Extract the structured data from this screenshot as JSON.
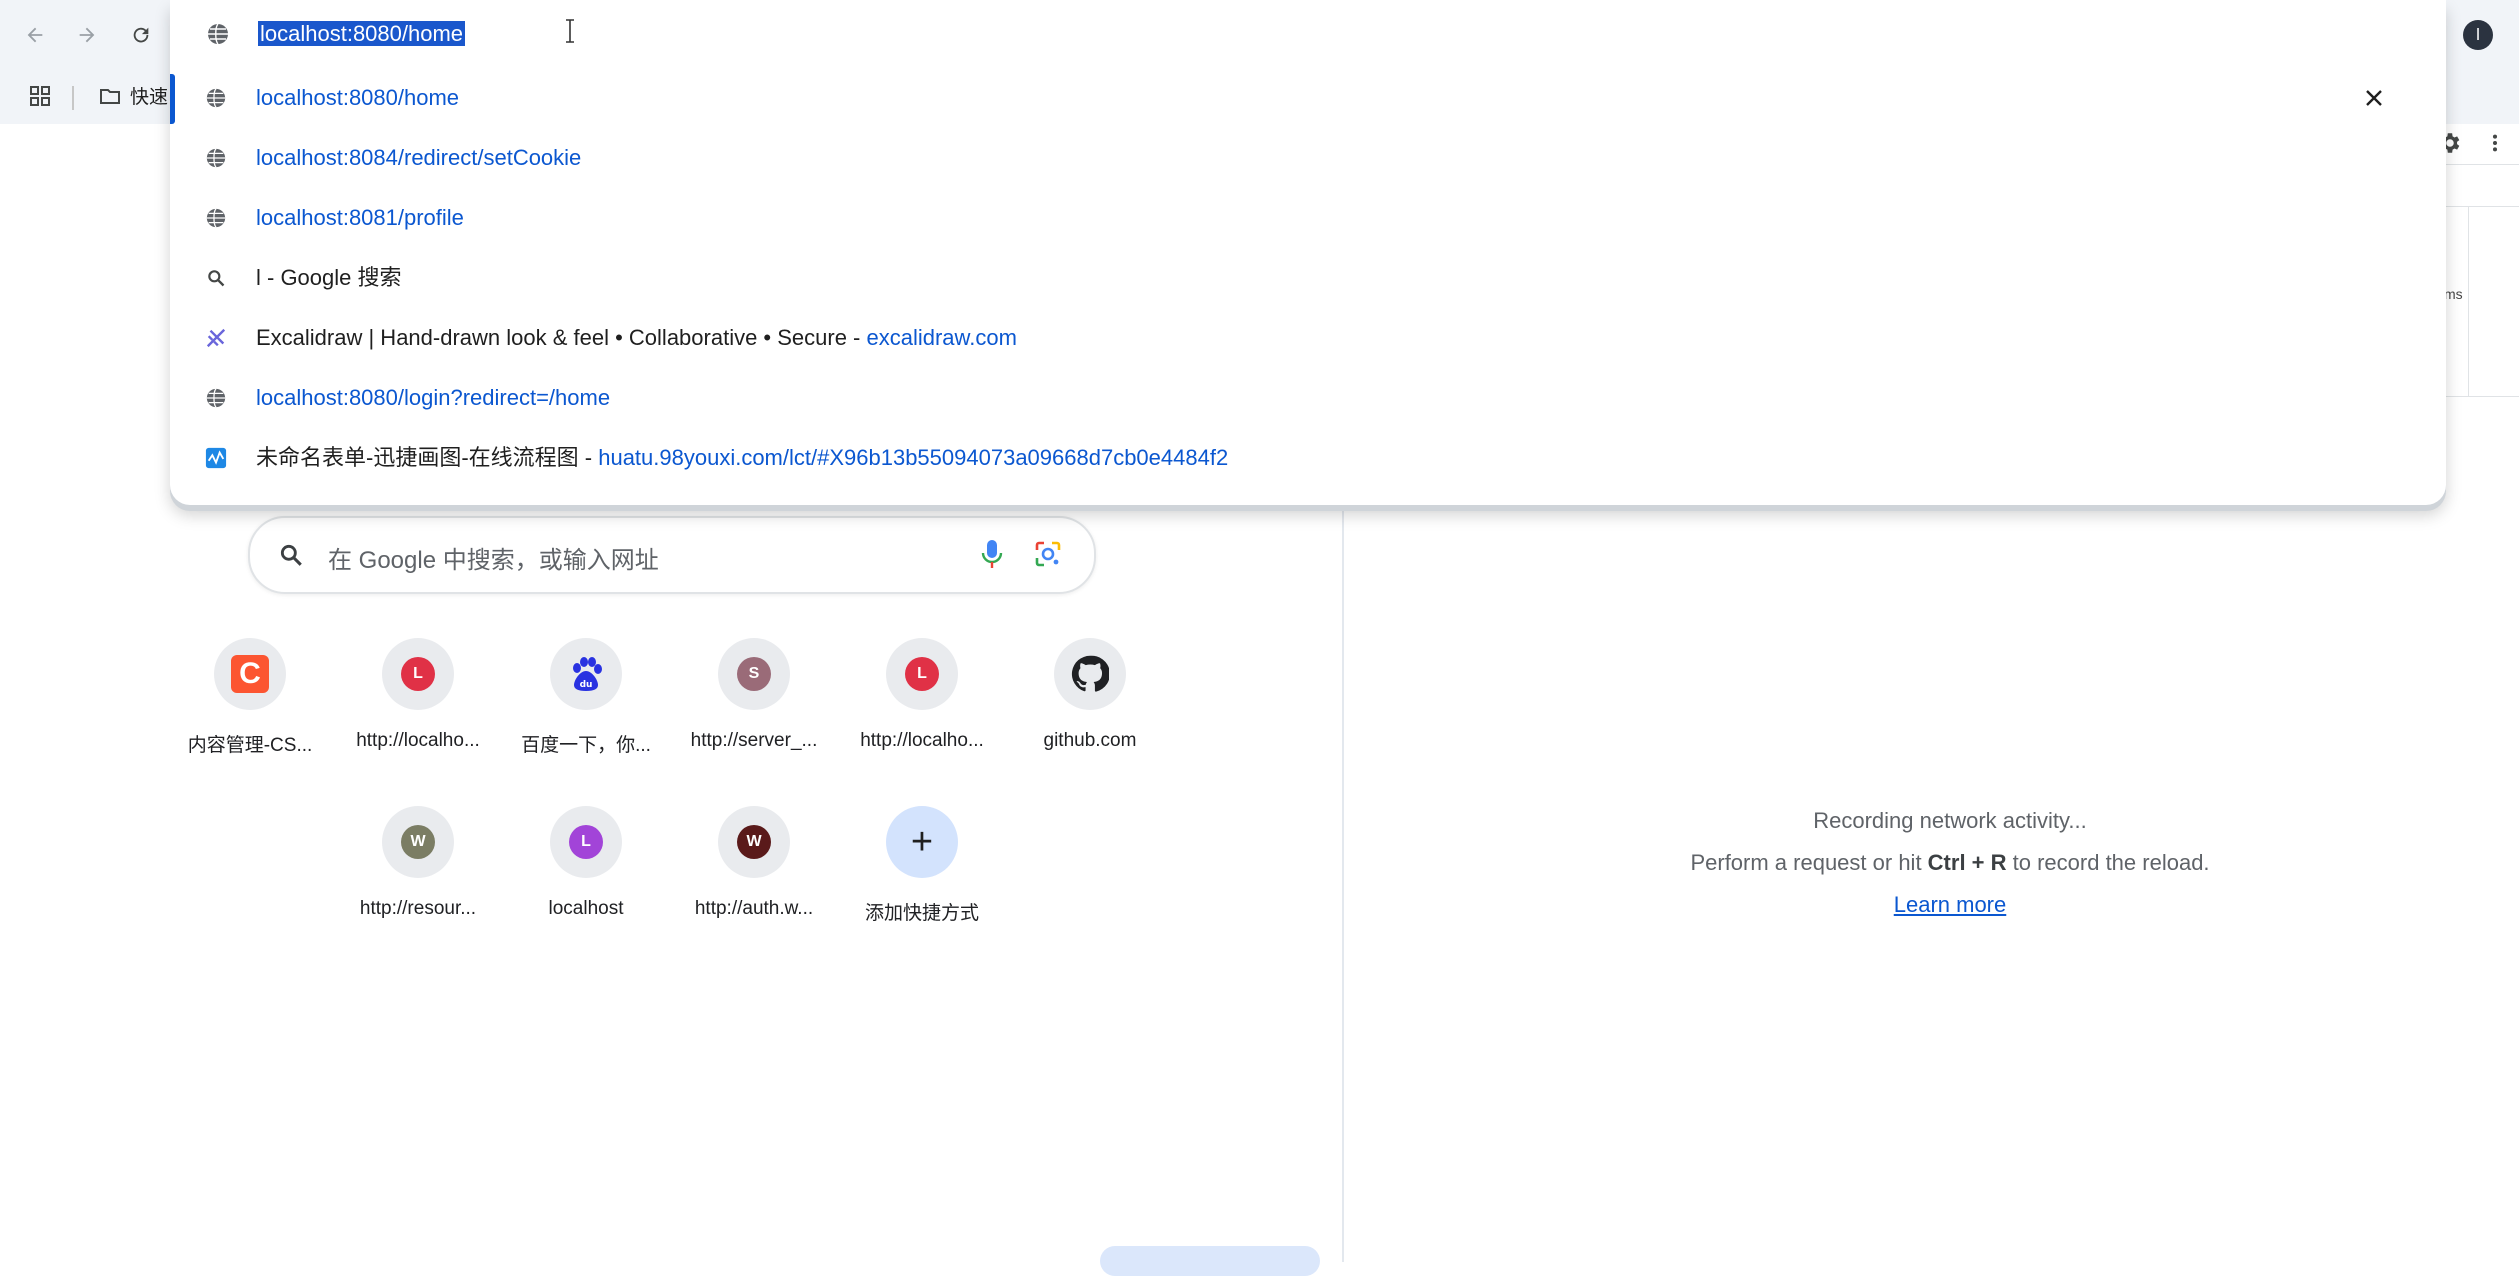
{
  "omnibox": {
    "text": "localhost:8080/home",
    "suggestions": [
      {
        "text": "localhost:8080/home",
        "icon": "globe-icon"
      },
      {
        "text": "localhost:8084/redirect/setCookie",
        "icon": "globe-icon"
      },
      {
        "text": "localhost:8081/profile",
        "icon": "globe-icon"
      },
      {
        "text": "l - Google 搜索",
        "icon": "search-icon"
      },
      {
        "text": "Excalidraw | Hand-drawn look & feel • Collaborative • Secure - ",
        "url": "excalidraw.com",
        "icon": "excalidraw-icon"
      },
      {
        "text": "localhost:8080/login?redirect=/home",
        "icon": "globe-icon"
      },
      {
        "text": "未命名表单-迅捷画图-在线流程图 - ",
        "url": "huatu.98youxi.com/lct/#X96b13b55094073a09668d7cb0e4484f2",
        "icon": "huatu-icon"
      }
    ]
  },
  "bookmarks": {
    "folder_label": "快速"
  },
  "profile": {
    "initial": "l"
  },
  "ntp": {
    "search_placeholder": "在 Google 中搜索，或输入网址",
    "shortcuts": [
      {
        "label": "内容管理-CS...",
        "icon": "csdn-icon",
        "letter": "C",
        "color": "#fc5531"
      },
      {
        "label": "http://localho...",
        "icon": "letter-icon",
        "letter": "L",
        "color": "#e03146"
      },
      {
        "label": "百度一下，你...",
        "icon": "baidu-icon",
        "letter": "du",
        "color": "#2932e1"
      },
      {
        "label": "http://server_...",
        "icon": "letter-icon",
        "letter": "S",
        "color": "#9a6b78"
      },
      {
        "label": "http://localho...",
        "icon": "letter-icon",
        "letter": "L",
        "color": "#e03146"
      },
      {
        "label": "github.com",
        "icon": "github-icon",
        "letter": "",
        "color": "#202124"
      },
      {
        "label": "http://resour...",
        "icon": "letter-icon",
        "letter": "W",
        "color": "#7b7d64"
      },
      {
        "label": "localhost",
        "icon": "letter-icon",
        "letter": "L",
        "color": "#a244d8"
      },
      {
        "label": "http://auth.w...",
        "icon": "letter-icon",
        "letter": "W",
        "color": "#5a1a1a"
      },
      {
        "label": "添加快捷方式",
        "icon": "plus-icon",
        "letter": "+",
        "color": "#1f1f1f"
      }
    ]
  },
  "devtools": {
    "timeline_unit": "ms",
    "recording": "Recording network activity...",
    "hint_prefix": "Perform a request or hit ",
    "hint_keys": "Ctrl + R",
    "hint_suffix": " to record the reload.",
    "learn_more": "Learn more"
  }
}
